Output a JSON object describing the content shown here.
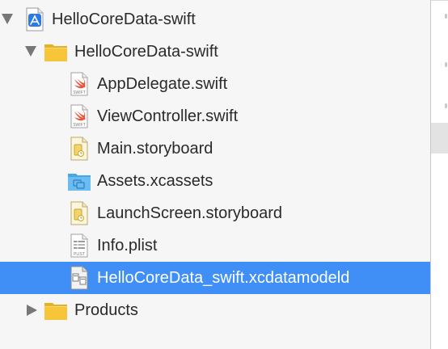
{
  "navigator": {
    "items": [
      {
        "label": "HelloCoreData-swift",
        "icon": "xcode-project-icon",
        "disclosure": "expanded"
      },
      {
        "label": "HelloCoreData-swift",
        "icon": "yellow-folder-icon",
        "disclosure": "expanded"
      },
      {
        "label": "AppDelegate.swift",
        "icon": "swift-file-icon",
        "icon_caption": "SWIFT"
      },
      {
        "label": "ViewController.swift",
        "icon": "swift-file-icon",
        "icon_caption": "SWIFT"
      },
      {
        "label": "Main.storyboard",
        "icon": "storyboard-file-icon"
      },
      {
        "label": "Assets.xcassets",
        "icon": "asset-catalog-folder-icon"
      },
      {
        "label": "LaunchScreen.storyboard",
        "icon": "storyboard-file-icon"
      },
      {
        "label": "Info.plist",
        "icon": "plist-file-icon",
        "icon_caption": "PLIST"
      },
      {
        "label": "HelloCoreData_swift.xcdatamodeld",
        "icon": "data-model-file-icon",
        "selected": true
      },
      {
        "label": "Products",
        "icon": "yellow-folder-icon",
        "disclosure": "collapsed"
      }
    ]
  },
  "colors": {
    "selection": "#3f8ff6",
    "folder": "#f7c53a",
    "swift": "#f05138",
    "text": "#2a2a2a"
  }
}
